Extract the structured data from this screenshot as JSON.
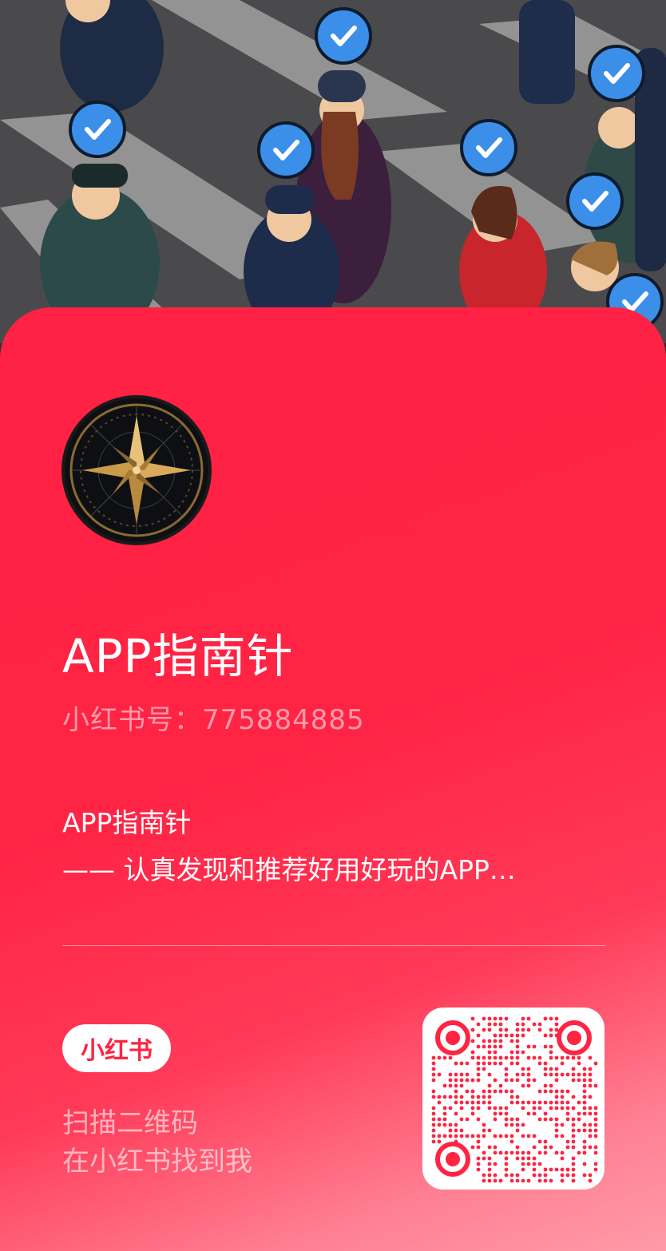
{
  "profile": {
    "nickname": "APP指南针",
    "red_id": "小红书号：775884885",
    "bio_line1": "APP指南针",
    "bio_line2": "—— 认真发现和推荐好用好玩的APP…"
  },
  "brand": {
    "logo_text": "小红书"
  },
  "scan": {
    "line1": "扫描二维码",
    "line2": "在小红书找到我"
  },
  "colors": {
    "card_primary": "#ff2244",
    "card_fade": "#ff9aa8",
    "qr_dots": "#ff2442",
    "verified_badge": "#3c8fe8"
  }
}
